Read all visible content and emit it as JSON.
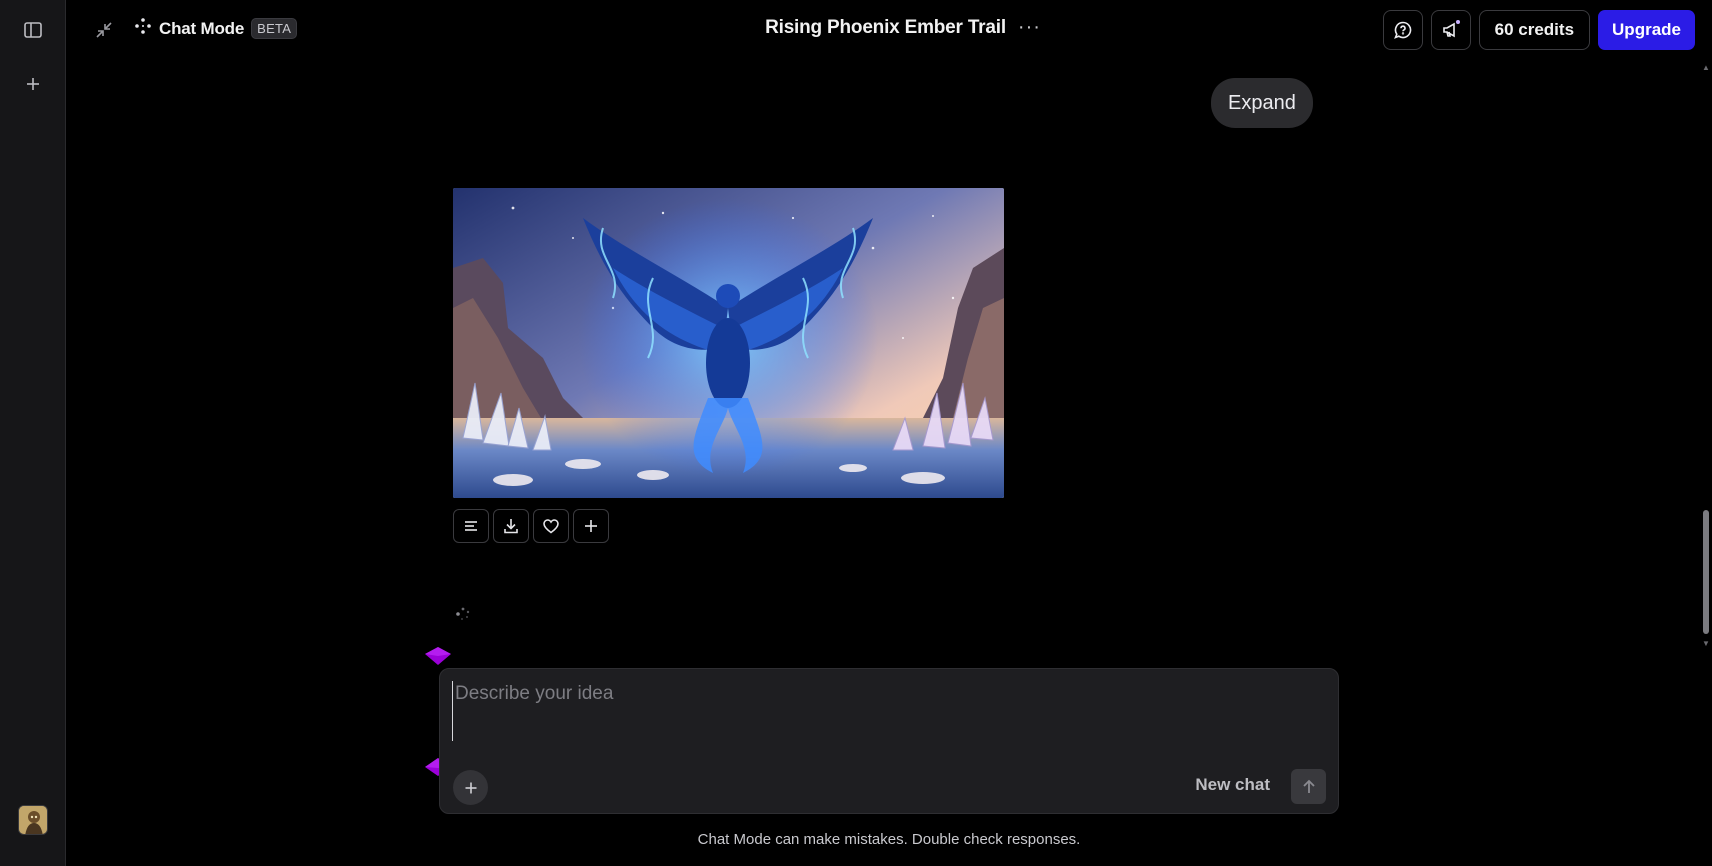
{
  "sidebar": {
    "toggle_icon": "sidebar-panel-icon",
    "new_icon": "plus-icon",
    "avatar_icon": "user-avatar"
  },
  "header": {
    "collapse_icon": "collapse-arrows-icon",
    "mode_label": "Chat Mode",
    "mode_badge": "BETA",
    "title": "Rising Phoenix Ember Trail",
    "title_menu": "···",
    "feedback_icon": "chat-help-icon",
    "announce_icon": "megaphone-icon",
    "credits": "60 credits",
    "upgrade": "Upgrade"
  },
  "message": {
    "expand_label": "Expand",
    "image_alt": "Blue phoenix with spread wings rising above crystals on a shore",
    "actions": [
      {
        "name": "details-icon"
      },
      {
        "name": "download-icon"
      },
      {
        "name": "heart-icon"
      },
      {
        "name": "plus-icon"
      }
    ]
  },
  "composer": {
    "placeholder": "Describe your idea",
    "value": "",
    "new_chat": "New chat",
    "attach_icon": "plus-icon",
    "send_icon": "arrow-up-icon"
  },
  "disclaimer": "Chat Mode can make mistakes. Double check responses.",
  "colors": {
    "background": "#000000",
    "rail": "#161618",
    "accent": "#2b1ce6",
    "composer": "#1e1e21",
    "pin": "#9b00d8"
  }
}
